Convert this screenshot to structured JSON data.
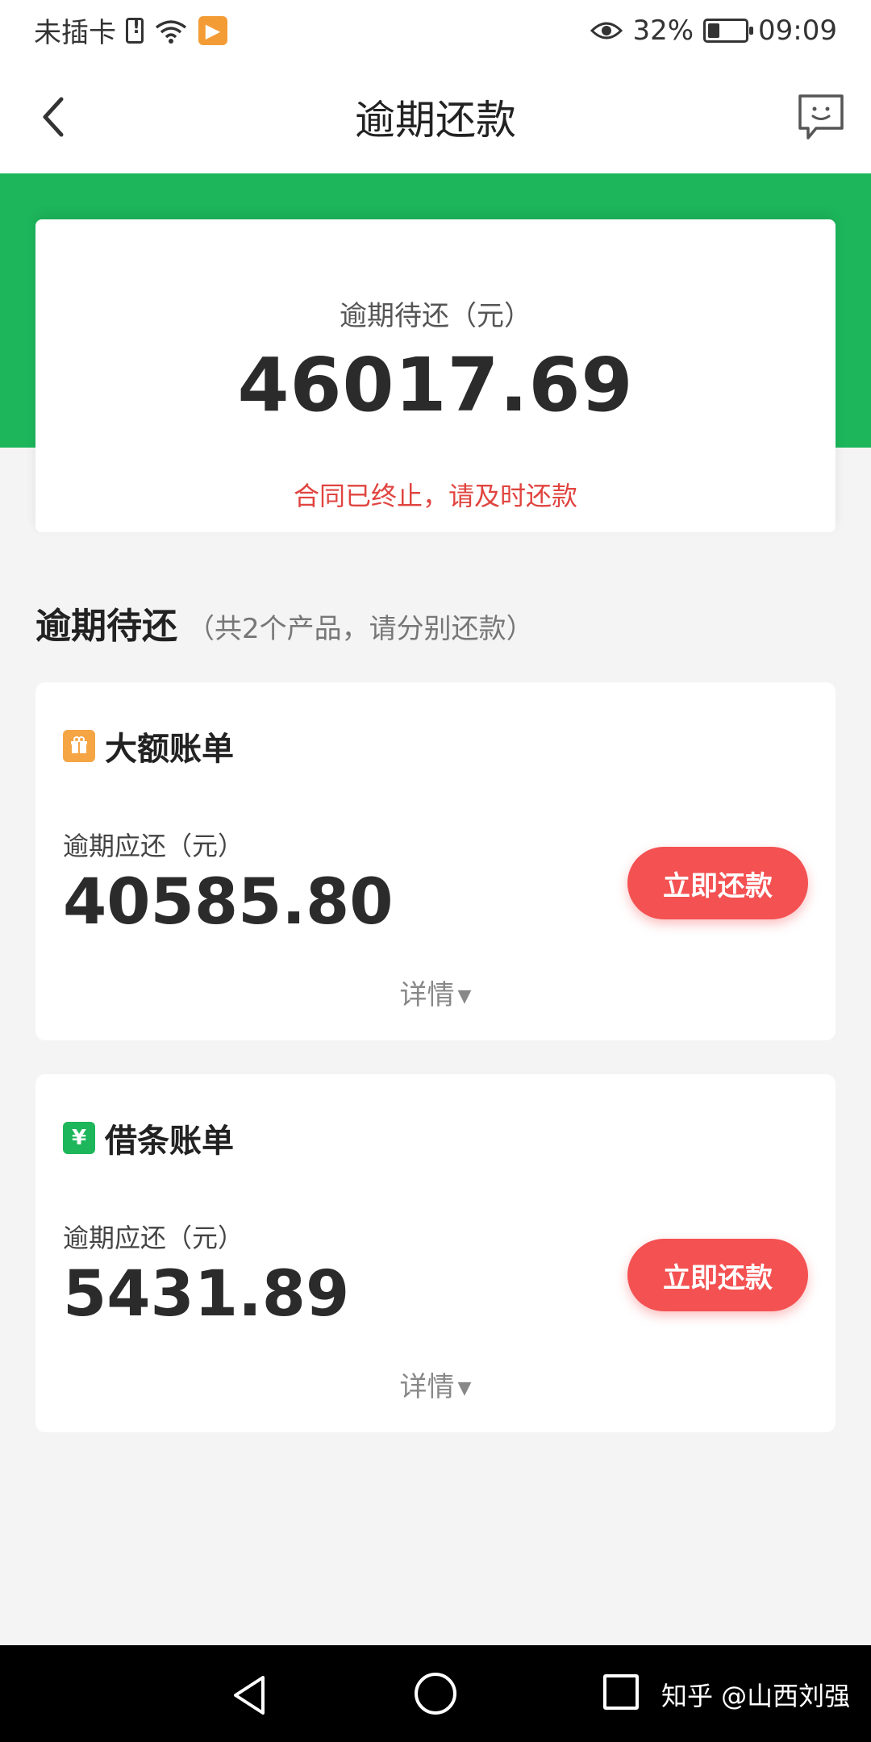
{
  "status_bar": {
    "carrier": "未插卡",
    "battery": "32%",
    "time": "09:09",
    "battery_level": 0.32
  },
  "nav": {
    "title": "逾期还款"
  },
  "summary": {
    "label": "逾期待还（元）",
    "amount": "46017.69",
    "warning": "合同已终止，请及时还款"
  },
  "section": {
    "title": "逾期待还",
    "subtitle": "（共2个产品，请分别还款）"
  },
  "bills": [
    {
      "name": "大额账单",
      "icon": "gift-icon",
      "icon_color": "#f5a544",
      "label": "逾期应还（元）",
      "amount": "40585.80",
      "button": "立即还款",
      "detail": "详情"
    },
    {
      "name": "借条账单",
      "icon": "yen-icon",
      "icon_glyph": "¥",
      "icon_color": "#1db65b",
      "label": "逾期应还（元）",
      "amount": "5431.89",
      "button": "立即还款",
      "detail": "详情"
    }
  ],
  "watermark": "知乎 @山西刘强",
  "colors": {
    "brand_green": "#1db65b",
    "action_red": "#f45152",
    "warning_red": "#e0443f"
  }
}
